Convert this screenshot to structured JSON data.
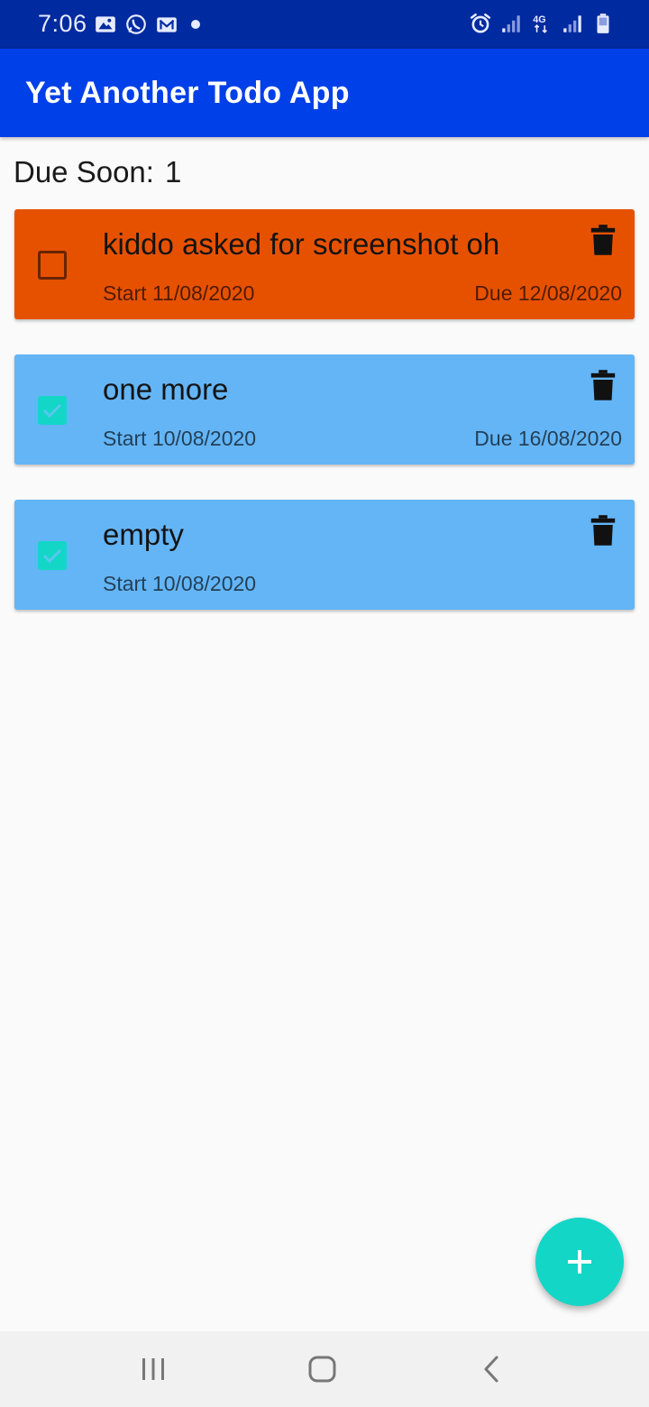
{
  "status_bar": {
    "time": "7:06",
    "left_icons": [
      "image-icon",
      "whatsapp-icon",
      "gmail-icon",
      "dot-icon"
    ],
    "right_icons": [
      "alarm-icon",
      "signal-icon",
      "4g-icon",
      "signal-icon",
      "battery-icon"
    ]
  },
  "app_bar": {
    "title": "Yet Another Todo App",
    "color": "#0040e8"
  },
  "due_soon": {
    "label": "Due Soon:",
    "count": "1"
  },
  "todos": [
    {
      "title": "kiddo asked for screenshot oh",
      "start": "Start 11/08/2020",
      "due": "Due 12/08/2020",
      "checked": false,
      "color": "#e65100"
    },
    {
      "title": "one more",
      "start": "Start 10/08/2020",
      "due": "Due 16/08/2020",
      "checked": true,
      "color": "#64b5f6"
    },
    {
      "title": "empty",
      "start": "Start 10/08/2020",
      "due": "",
      "checked": true,
      "color": "#64b5f6"
    }
  ],
  "fab": {
    "icon": "plus-icon",
    "color": "#14d6c7"
  },
  "nav_bar": {
    "icons": [
      "recents-icon",
      "home-icon",
      "back-icon"
    ]
  }
}
